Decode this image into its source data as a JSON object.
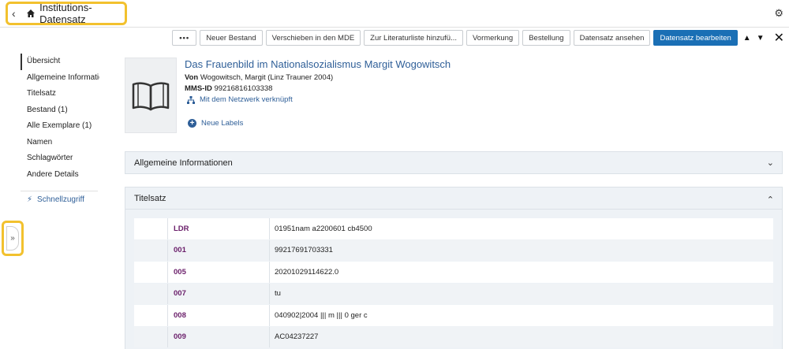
{
  "header": {
    "title": "Institutions-Datensatz",
    "back_icon": "chevron-left-icon",
    "home_icon": "home-icon",
    "settings_icon": "gear-icon"
  },
  "toolbar": {
    "more_label": "•••",
    "buttons": [
      "Neuer Bestand",
      "Verschieben in den MDE",
      "Zur Literaturliste hinzufü...",
      "Vormerkung",
      "Bestellung",
      "Datensatz ansehen"
    ],
    "primary_label": "Datensatz bearbeiten",
    "up_label": "▲",
    "down_label": "▼",
    "close_label": "✕"
  },
  "nav": {
    "items": [
      "Übersicht",
      "Allgemeine Informatio...",
      "Titelsatz",
      "Bestand (1)",
      "Alle Exemplare (1)",
      "Namen",
      "Schlagwörter",
      "Andere Details"
    ],
    "quick_label": "Schnellzugriff"
  },
  "expand_label": "»",
  "record": {
    "title": "Das Frauenbild im Nationalsozialismus Margit Wogowitsch",
    "by_label": "Von",
    "by_value": " Wogowitsch, Margit (Linz Trauner 2004)",
    "mms_label": "MMS-ID",
    "mms_value": " 99216816103338",
    "network_label": "Mit dem Netzwerk verknüpft",
    "labels_label": "Neue Labels"
  },
  "panels": {
    "general_label": "Allgemeine Informationen",
    "titelsatz_label": "Titelsatz"
  },
  "titelsatz": [
    {
      "tag": "LDR",
      "value": "01951nam a2200601 cb4500"
    },
    {
      "tag": "001",
      "value": "99217691703331"
    },
    {
      "tag": "005",
      "value": "20201029114622.0"
    },
    {
      "tag": "007",
      "value": "tu"
    },
    {
      "tag": "008",
      "value": "040902|2004 ||| m ||| 0 ger c"
    },
    {
      "tag": "009",
      "value": "AC04237227"
    }
  ],
  "colors": {
    "accent": "#1a6fb5",
    "link": "#2f5f98",
    "tag": "#6a1e6a",
    "highlight": "#f2c12e",
    "panel": "#eef2f6"
  }
}
